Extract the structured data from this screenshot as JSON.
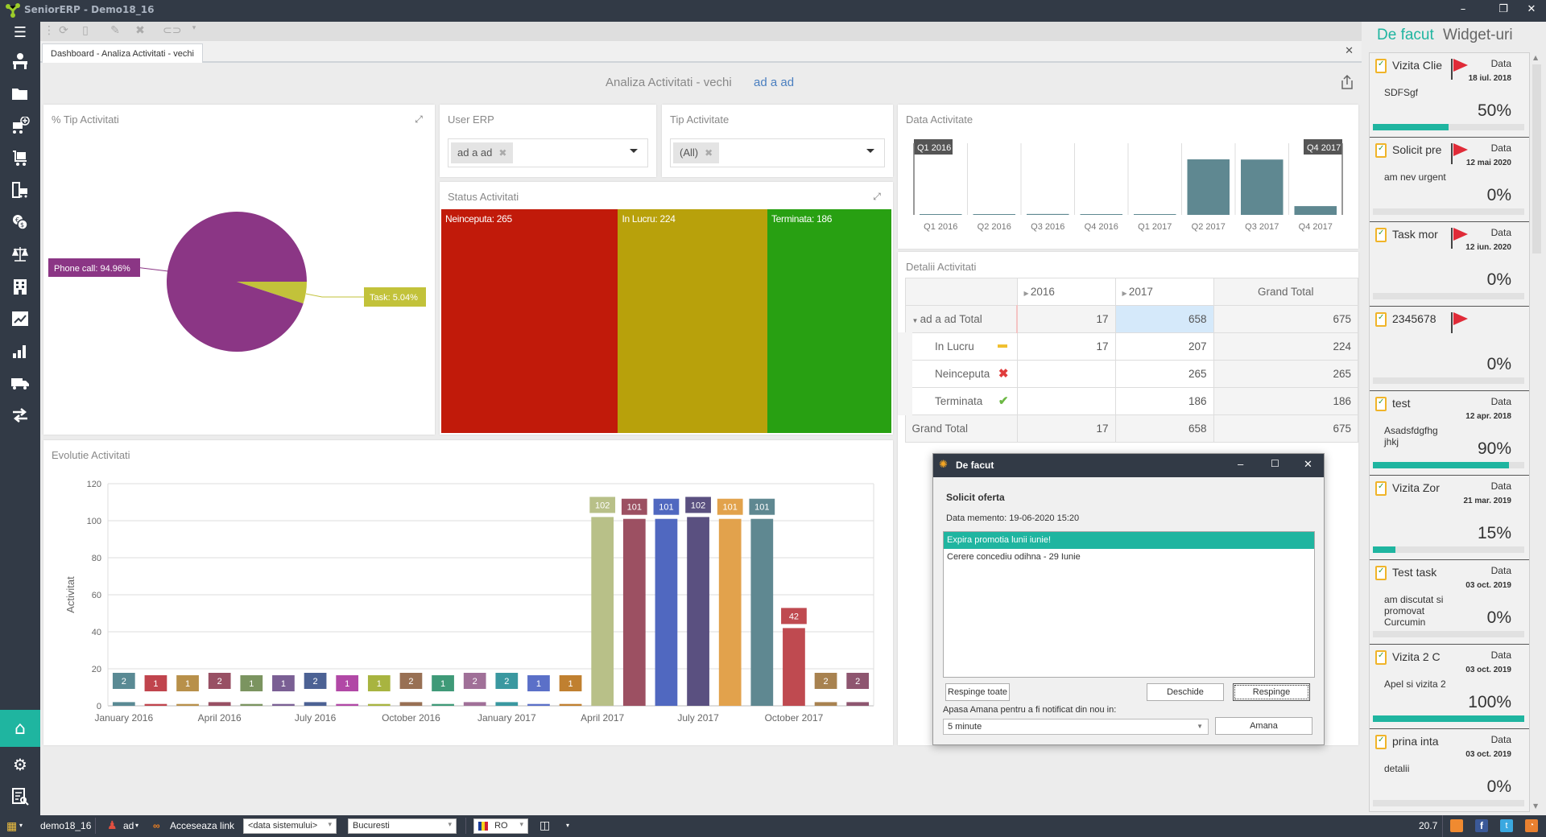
{
  "app": {
    "title": "SeniorERP - Demo18_16",
    "window_controls": [
      "minimize",
      "restore",
      "close"
    ]
  },
  "sidebar": {
    "items": [
      "menu",
      "reception",
      "documents",
      "add-to-cart",
      "cart",
      "inventory",
      "finance",
      "balance",
      "company",
      "reports-trend",
      "statistics",
      "delivery",
      "transfer"
    ],
    "active": "home",
    "bottom": [
      "home",
      "settings",
      "report-search"
    ]
  },
  "tab": {
    "label": "Dashboard - Analiza Activitati - vechi"
  },
  "dashboard": {
    "title": "Analiza Activitati - vechi",
    "user": "ad a ad"
  },
  "panels": {
    "pie": {
      "title": "% Tip Activitati"
    },
    "user_erp": {
      "title": "User ERP",
      "chip": "ad a ad"
    },
    "tip_activitate": {
      "title": "Tip Activitate",
      "chip": "(All)"
    },
    "status": {
      "title": "Status Activitati"
    },
    "data_activitate": {
      "title": "Data Activitate",
      "range_start": "Q1 2016",
      "range_end": "Q4 2017"
    },
    "detalii": {
      "title": "Detalii Activitati"
    },
    "evolutie": {
      "title": "Evolutie Activitati"
    }
  },
  "chart_data": [
    {
      "type": "pie",
      "title": "% Tip Activitati",
      "slices": [
        {
          "label": "Phone call",
          "value": 94.96,
          "display": "Phone call: 94.96%",
          "color": "#8b3685"
        },
        {
          "label": "Task",
          "value": 5.04,
          "display": "Task: 5.04%",
          "color": "#c2c23a"
        }
      ]
    },
    {
      "type": "heatmap",
      "title": "Status Activitati",
      "items": [
        {
          "label": "Neinceputa",
          "value": 265,
          "display": "Neinceputa: 265",
          "color": "#c11a0a"
        },
        {
          "label": "In Lucru",
          "value": 224,
          "display": "In Lucru: 224",
          "color": "#b8a10b"
        },
        {
          "label": "Terminata",
          "value": 186,
          "display": "Terminata: 186",
          "color": "#28a012"
        }
      ]
    },
    {
      "type": "bar",
      "title": "Data Activitate",
      "categories": [
        "Q1 2016",
        "Q2 2016",
        "Q3 2016",
        "Q4 2016",
        "Q1 2017",
        "Q2 2017",
        "Q3 2017",
        "Q4 2017"
      ],
      "values": [
        4,
        4,
        5,
        4,
        3,
        304,
        303,
        48
      ],
      "color": "#5f8891"
    },
    {
      "type": "bar",
      "title": "Evolutie Activitati",
      "ylabel": "Activitat",
      "ylim": [
        0,
        120
      ],
      "yticks": [
        0,
        20,
        40,
        60,
        80,
        100,
        120
      ],
      "xtick_labels": [
        "January 2016",
        "April 2016",
        "July 2016",
        "October 2016",
        "January 2017",
        "April 2017",
        "July 2017",
        "October 2017"
      ],
      "xtick_indices": [
        0,
        3,
        6,
        9,
        12,
        15,
        18,
        21
      ],
      "values": [
        2,
        1,
        1,
        2,
        1,
        1,
        2,
        1,
        1,
        2,
        1,
        2,
        2,
        1,
        1,
        102,
        101,
        101,
        102,
        101,
        101,
        42,
        2,
        2
      ],
      "colors": [
        "#5a8a94",
        "#c0444d",
        "#b8904a",
        "#985064",
        "#7b9460",
        "#7a5f94",
        "#4c6294",
        "#b148a6",
        "#a8b440",
        "#987054",
        "#3f9a78",
        "#a07098",
        "#3a98a0",
        "#5b70c8",
        "#c08030",
        "#b8c088",
        "#9c5062",
        "#5068c0",
        "#5a5080",
        "#e2a24c",
        "#5f8891",
        "#bf4a50",
        "#a88250",
        "#8e5670"
      ],
      "grid": true
    }
  ],
  "pivot": {
    "columns": [
      "2016",
      "2017",
      "Grand Total"
    ],
    "rows": [
      {
        "label": "ad a ad Total",
        "values": [
          "17",
          "658",
          "675"
        ],
        "expanded": true
      },
      {
        "label": "In Lucru",
        "icon": "dash-icon",
        "values": [
          "17",
          "207",
          "224"
        ]
      },
      {
        "label": "Neinceputa",
        "icon": "cross-icon",
        "values": [
          "",
          "265",
          "265"
        ]
      },
      {
        "label": "Terminata",
        "icon": "check-icon",
        "values": [
          "",
          "186",
          "186"
        ]
      },
      {
        "label": "Grand Total",
        "values": [
          "17",
          "658",
          "675"
        ]
      }
    ]
  },
  "right_panel": {
    "tabs": [
      "De facut",
      "Widget-uri"
    ],
    "active_tab": "De facut",
    "date_label": "Data",
    "tasks": [
      {
        "name": "Vizita Clie",
        "flag": true,
        "date": "18 iul. 2018",
        "desc": "SDFSgf",
        "percent": "50%",
        "progress": 50
      },
      {
        "name": "Solicit pre",
        "flag": true,
        "date": "12 mai 2020",
        "desc": "am nev urgent",
        "percent": "0%",
        "progress": 0
      },
      {
        "name": "Task mor",
        "flag": true,
        "date": "12 iun. 2020",
        "desc": "",
        "percent": "0%",
        "progress": 0
      },
      {
        "name": "2345678",
        "flag": true,
        "date": "",
        "desc": "",
        "percent": "0%",
        "progress": 0
      },
      {
        "name": "test",
        "flag": false,
        "date": "12 apr. 2018",
        "desc": "Asadsfdgfhg jhkj",
        "percent": "90%",
        "progress": 90
      },
      {
        "name": "Vizita Zor",
        "flag": false,
        "date": "21 mar. 2019",
        "desc": "",
        "percent": "15%",
        "progress": 15
      },
      {
        "name": "Test task",
        "flag": false,
        "date": "03 oct. 2019",
        "desc": "am discutat si promovat Curcumin",
        "percent": "0%",
        "progress": 0
      },
      {
        "name": "Vizita 2 C",
        "flag": false,
        "date": "03 oct. 2019",
        "desc": "Apel si vizita 2",
        "percent": "100%",
        "progress": 100
      },
      {
        "name": "prina inta",
        "flag": false,
        "date": "03 oct. 2019",
        "desc": "detalii",
        "percent": "0%",
        "progress": 0
      }
    ]
  },
  "dialog": {
    "title": "De facut",
    "heading": "Solicit oferta",
    "memento": "Data memento: 19-06-2020 15:20",
    "list": [
      "Expira promotia lunii iunie!",
      "Cerere concediu odihna - 29 Iunie"
    ],
    "selected_index": 0,
    "buttons": {
      "reject_all": "Respinge toate",
      "open": "Deschide",
      "reject": "Respinge",
      "snooze": "Amana"
    },
    "snooze_label": "Apasa Amana pentru a fi notificat din nou in:",
    "snooze_value": "5 minute"
  },
  "statusbar": {
    "db": "demo18_16",
    "user": "ad",
    "link": "Acceseaza link",
    "date_combo": "<data sistemului>",
    "city_combo": "Bucuresti",
    "lang": "RO",
    "version": "20.7"
  },
  "colors": {
    "accent": "#1fb5a0",
    "dark": "#323a46",
    "flag": "#e02b38"
  }
}
